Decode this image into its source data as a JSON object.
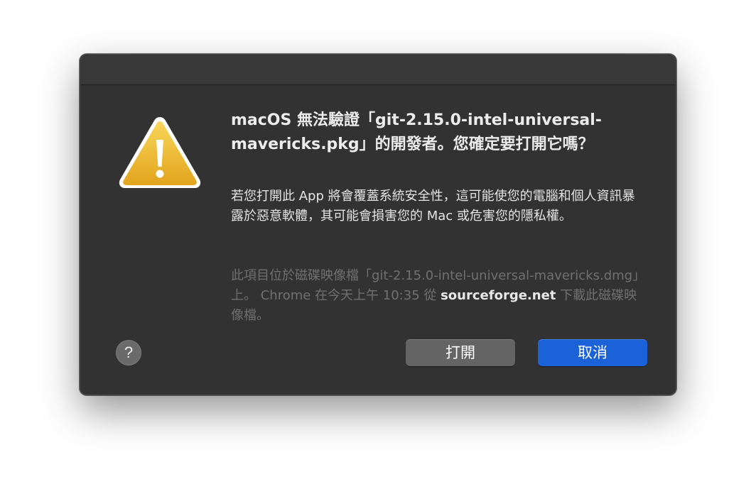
{
  "dialog": {
    "heading": "macOS 無法驗證「git-2.15.0-intel-universal-mavericks.pkg」的開發者。您確定要打開它嗎？",
    "body": "若您打開此 App 將會覆蓋系統安全性，這可能使您的電腦和個人資訊暴露於惡意軟體，其可能會損害您的 Mac 或危害您的隱私權。",
    "source_prefix": "此項目位於磁碟映像檔「git-2.15.0-intel-universal-mavericks.dmg」上。 Chrome 在今天上午 10:35 從 ",
    "source_site": "sourceforge.net",
    "source_suffix": " 下載此磁碟映像檔。",
    "icon": "warning-triangle-icon",
    "help_label": "?",
    "help_icon": "question-mark-icon",
    "open_label": "打開",
    "cancel_label": "取消",
    "colors": {
      "dialog_bg": "#323232",
      "warning_yellow": "#f2c230",
      "cancel_blue": "#1b62d9",
      "open_gray": "#646464"
    }
  }
}
